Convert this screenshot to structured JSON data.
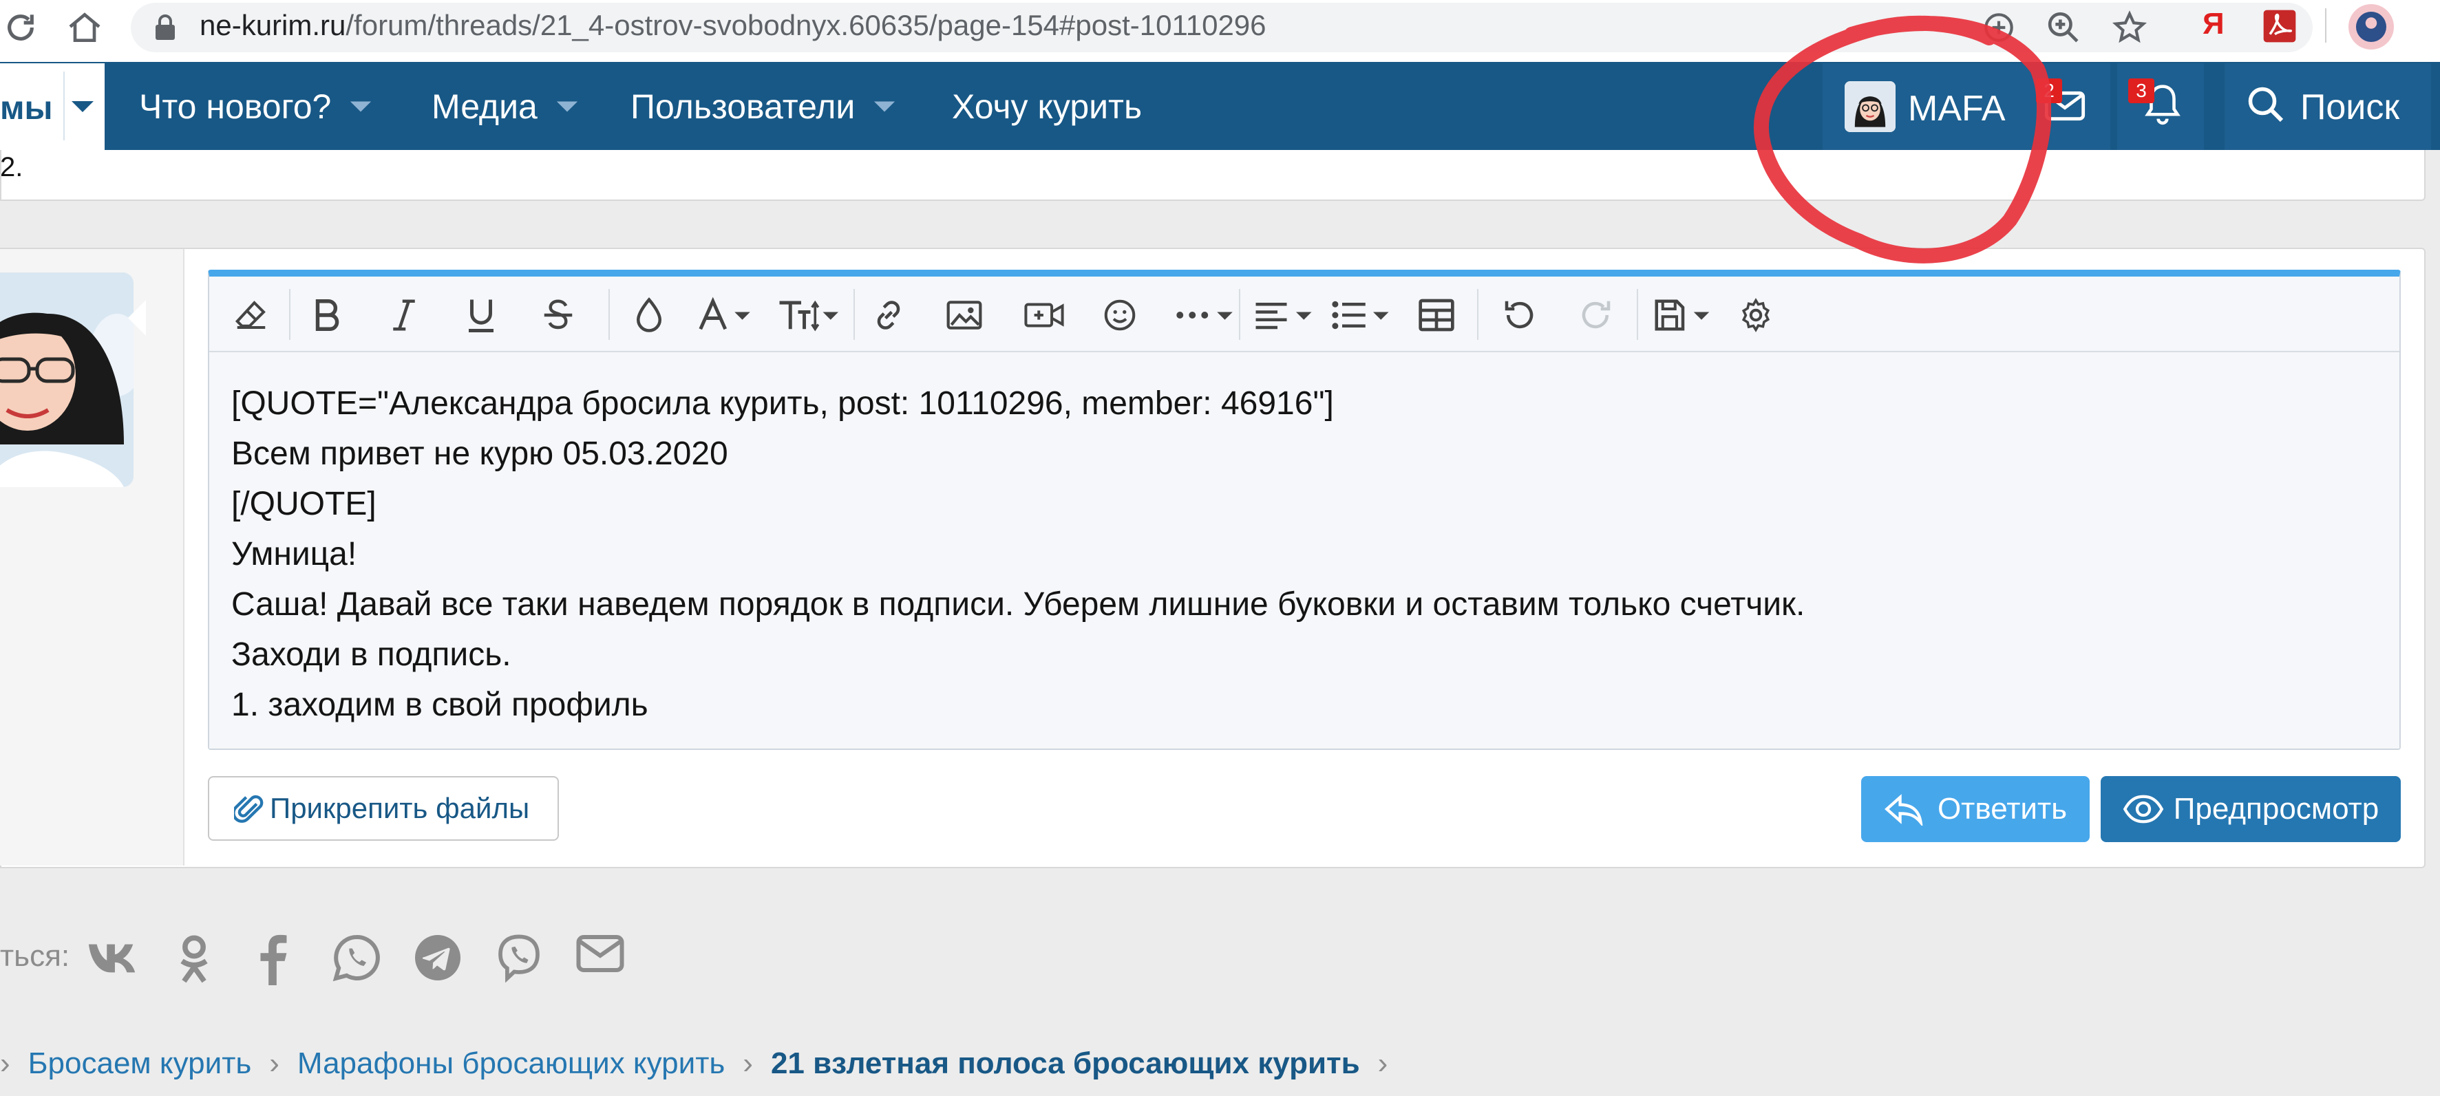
{
  "browser": {
    "url_domain": "ne-kurim.ru",
    "url_path": "/forum/threads/21_4-ostrov-svobodnyx.60635/page-154#post-10110296",
    "ext_ya_label": "Я"
  },
  "nav": {
    "forums_fragment": "мы",
    "items": [
      {
        "label": "Что нового?"
      },
      {
        "label": "Медиа"
      },
      {
        "label": "Пользователи"
      },
      {
        "label": "Хочу курить"
      }
    ],
    "username": "MAFA",
    "inbox_count": "2",
    "alerts_count": "3",
    "search_label": "Поиск"
  },
  "prev_post": {
    "fragment": "2."
  },
  "editor": {
    "lines": [
      "[QUOTE=\"Александра бросила курить, post: 10110296, member: 46916\"]",
      "Всем привет не курю 05.03.2020",
      "[/QUOTE]",
      "Умница!",
      "Саша! Давай все таки наведем порядок в подписи. Уберем лишние буковки и оставим только счетчик.",
      "Заходи в подпись.",
      "1. заходим в свой профиль"
    ],
    "attach_label": "Прикрепить файлы",
    "reply_label": "Ответить",
    "preview_label": "Предпросмотр"
  },
  "share": {
    "label_fragment": "ться:",
    "icons": [
      "vk-icon",
      "odnoklassniki-icon",
      "facebook-icon",
      "whatsapp-icon",
      "telegram-icon",
      "viber-icon",
      "email-icon"
    ]
  },
  "breadcrumb": {
    "items": [
      {
        "label": "Бросаем курить"
      },
      {
        "label": "Марафоны бросающих курить"
      },
      {
        "label": "21 взлетная полоса бросающих курить"
      }
    ]
  },
  "colors": {
    "nav_bg": "#185886",
    "accent_blue": "#47a7eb",
    "button_dark": "#2577b1",
    "badge_red": "#e01f1f",
    "annotation_red": "#e8323c"
  }
}
